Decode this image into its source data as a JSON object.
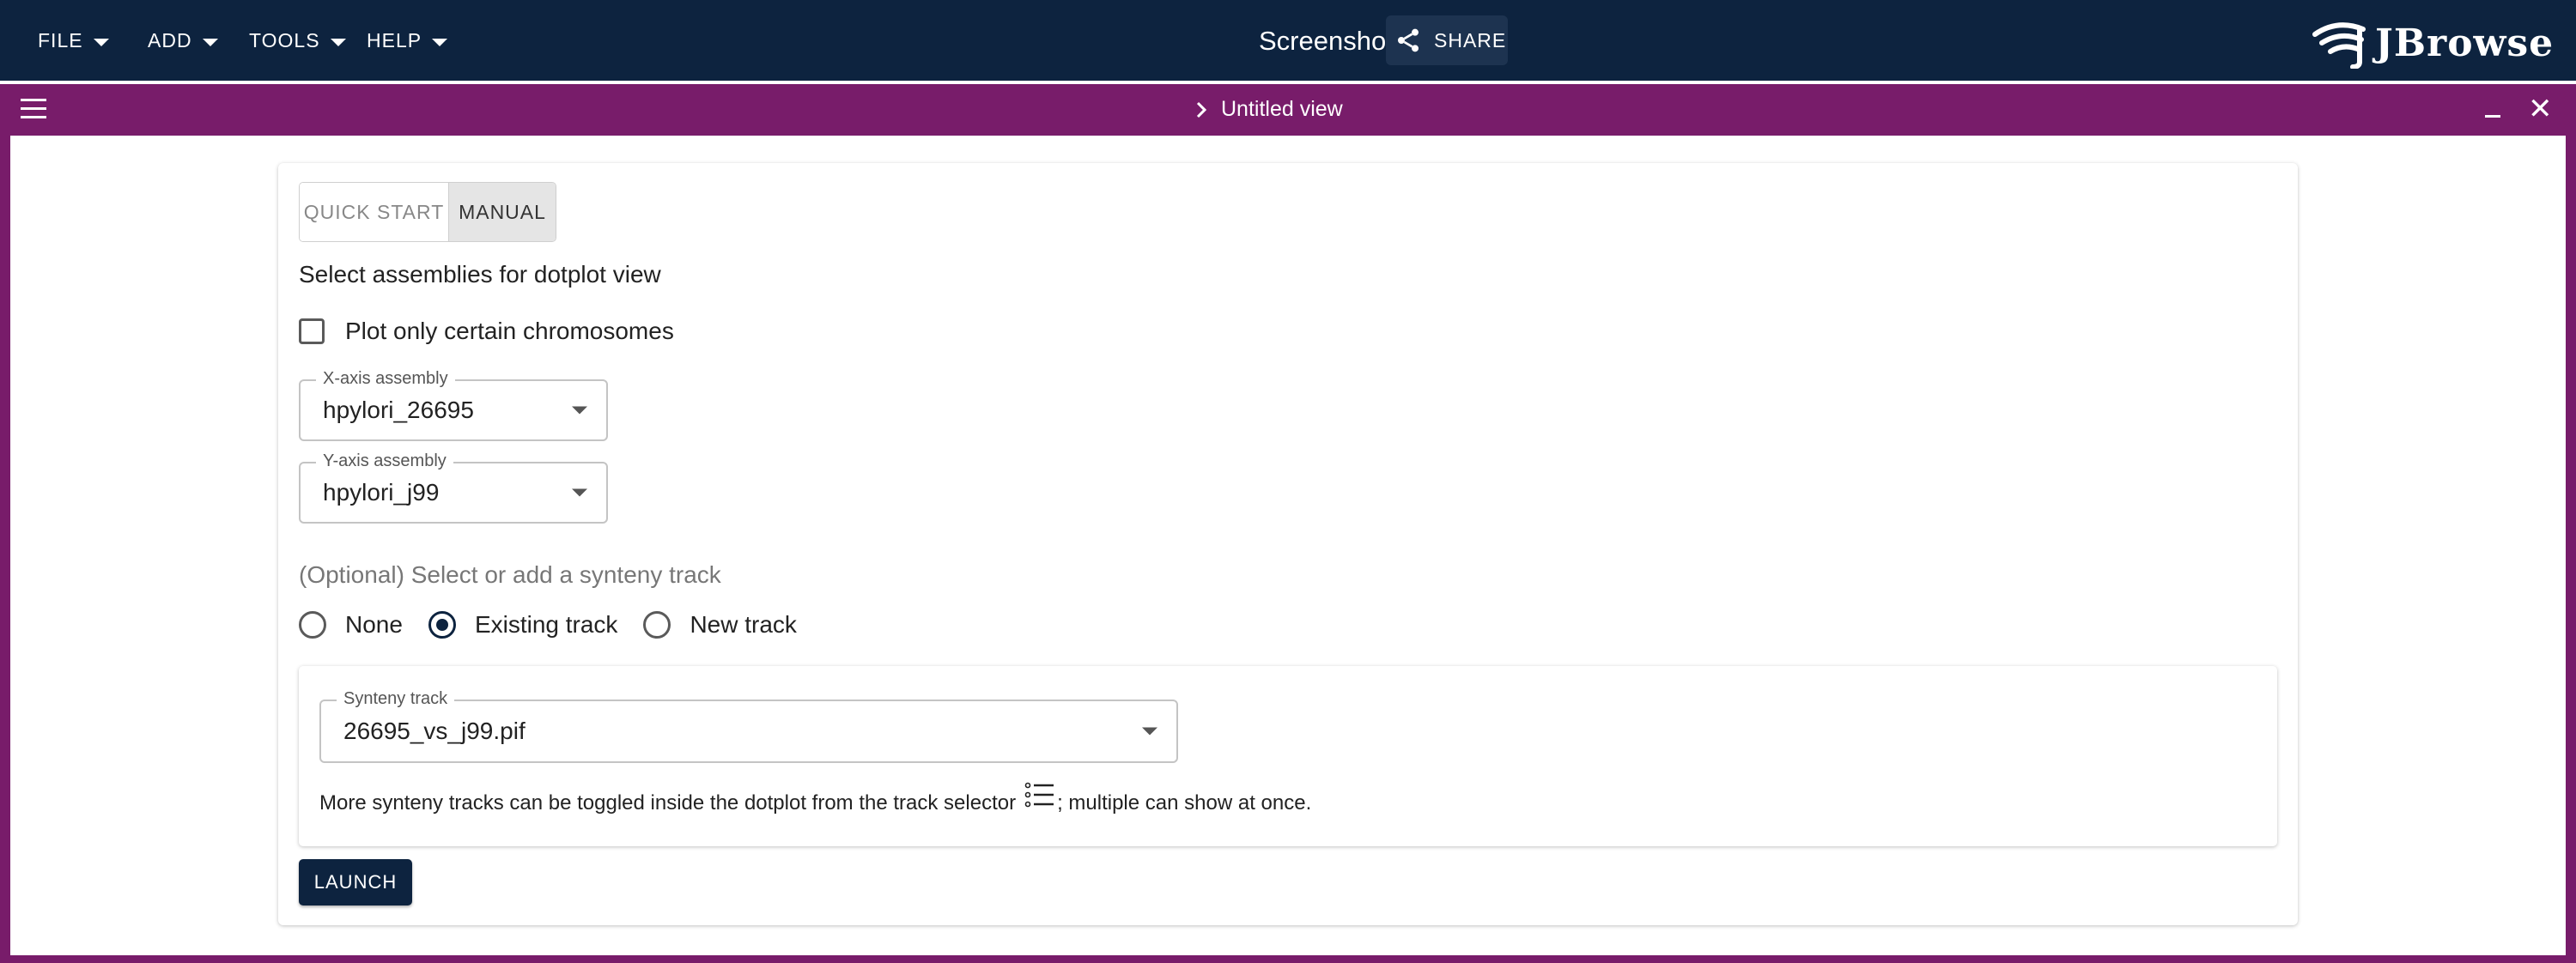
{
  "menu": {
    "file": "FILE",
    "add": "ADD",
    "tools": "TOOLS",
    "help": "HELP"
  },
  "header": {
    "session_name": "Screenshot",
    "share_label": "SHARE",
    "logo_text": "JBrowse"
  },
  "view": {
    "title": "Untitled view"
  },
  "tabs": {
    "quick_start": "QUICK START",
    "manual": "MANUAL",
    "selected": "MANUAL"
  },
  "form": {
    "heading": "Select assemblies for dotplot view",
    "checkbox_label": "Plot only certain chromosomes",
    "checkbox_checked": false,
    "x_axis": {
      "label": "X-axis assembly",
      "value": "hpylori_26695"
    },
    "y_axis": {
      "label": "Y-axis assembly",
      "value": "hpylori_j99"
    },
    "optional_heading": "(Optional) Select or add a synteny track",
    "radio": {
      "none": "None",
      "existing": "Existing track",
      "new": "New track",
      "selected": "Existing track"
    },
    "synteny_track": {
      "label": "Synteny track",
      "value": "26695_vs_j99.pif"
    },
    "hint_before": "More synteny tracks can be toggled inside the dotplot from the track selector",
    "hint_after": "; multiple can show at once.",
    "launch_label": "LAUNCH"
  },
  "colors": {
    "appbar": "#0d233f",
    "view_frame": "#781c6a",
    "primary": "#0d233f"
  },
  "icons": {
    "share": "share-icon",
    "menu": "hamburger-menu-icon",
    "expand": "chevron-right-icon",
    "minimize": "minimize-icon",
    "close": "close-icon",
    "track_selector": "format-list-bulleted-icon"
  }
}
